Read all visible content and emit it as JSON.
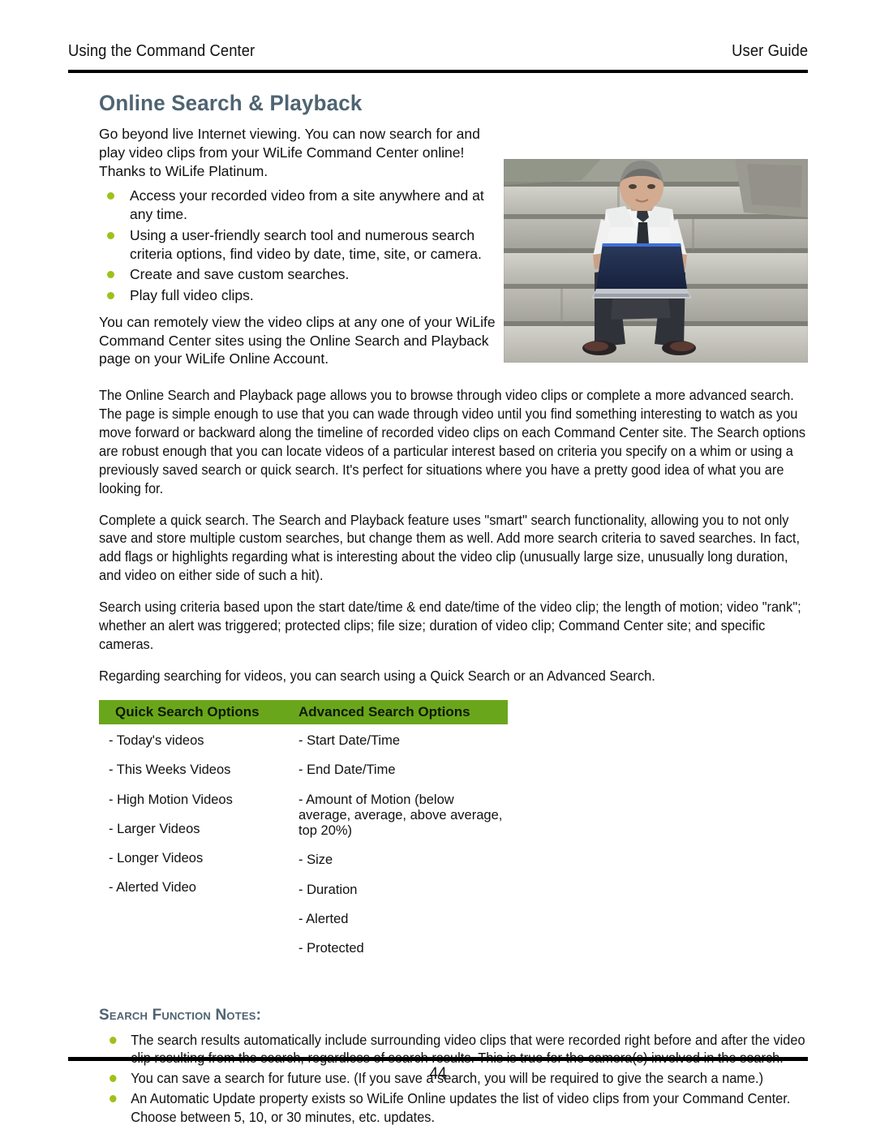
{
  "header": {
    "left_title": "Using the Command Center",
    "right_title": "User Guide"
  },
  "page_title": "Online Search & Playback",
  "intro": {
    "paragraph": "Go beyond live Internet viewing. You can now search for and play video clips from your WiLife Command Center online! Thanks to WiLife Platinum.",
    "bullets": [
      "Access your recorded video from a site anywhere and at any time.",
      "Using a user-friendly search tool and numerous search criteria options, find video by date, time, site, or camera.",
      "Create and save custom searches.",
      "Play full video clips."
    ],
    "closing_paragraph": "You can remotely view the video clips at any one of your WiLife Command Center sites using the Online Search and Playback page on your WiLife Online Account."
  },
  "photo": {
    "alt": "Man in white shirt and tie sitting on stone steps using a laptop computer"
  },
  "body_paragraphs": [
    "The Online Search and Playback page allows you to browse through video clips or complete a more advanced search.  The page is simple enough to use that you can wade through video until you find something interesting to watch as you move forward or backward along the timeline of recorded video clips on each Command Center site.  The Search options are robust enough that you can locate videos of a particular interest based on criteria you specify on a whim or using a previously saved search or quick search.  It's perfect for situations where you have a pretty good idea of what you are looking for.",
    "Complete a quick search.  The Search and Playback feature uses \"smart\" search functionality, allowing you to not only save and store multiple custom searches, but change them as well.  Add more search criteria to saved searches. In fact, add flags or highlights regarding what is interesting about the video clip (unusually large size, unusually long duration, and video on either side of such a hit).",
    "Search using criteria based upon the start date/time & end date/time of the video clip; the length of motion; video \"rank\";  whether an alert was triggered;  protected clips; file size; duration of video clip; Command Center site; and specific cameras.",
    "Regarding searching for videos, you can search using a Quick Search or an Advanced Search."
  ],
  "options_table": {
    "header_color": "#6aa61b",
    "columns": [
      {
        "label": "Quick Search Options",
        "items": [
          "- Today's videos",
          "- This Weeks Videos",
          "- High Motion Videos",
          "- Larger Videos",
          "- Longer Videos",
          "- Alerted Video"
        ]
      },
      {
        "label": "Advanced Search Options",
        "items": [
          "- Start Date/Time",
          "- End Date/Time",
          "- Amount of Motion (below average, average, above average, top 20%)",
          "- Size",
          "- Duration",
          "- Alerted",
          "- Protected"
        ]
      }
    ]
  },
  "notes": {
    "heading": "Search Function Notes:",
    "bullets": [
      "The search results automatically include surrounding video clips that were recorded right before and after the video clip resulting from the search, regardless of search results.  This is true for the camera(s) involved in the search.",
      "You can save a search for future use. (If you save a search, you will be required to give the search a name.)",
      "An Automatic Update property exists so WiLife Online updates the list of video clips from your Command Center.  Choose between 5, 10, or 30 minutes, etc. updates."
    ]
  },
  "footer": {
    "page_number": "44"
  },
  "colors": {
    "heading_slate": "#4f6472",
    "bullet_green": "#9ec11a",
    "table_header_green": "#6aa61b",
    "rule_black": "#000000"
  }
}
